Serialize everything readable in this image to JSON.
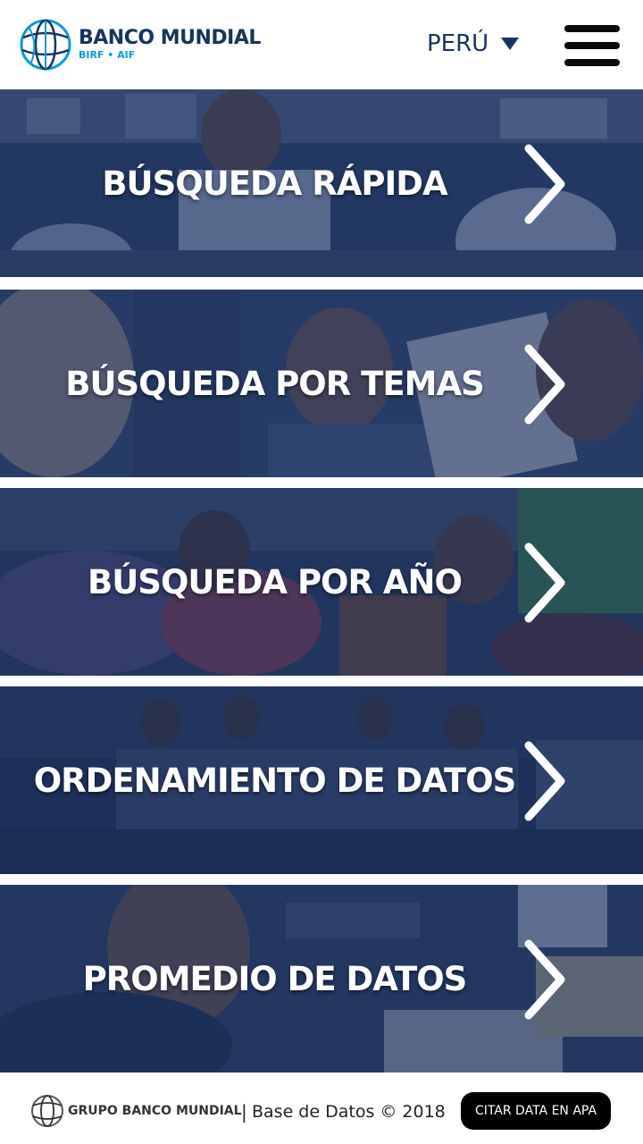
{
  "header": {
    "logo_title": "BANCO MUNDIAL",
    "logo_subtitle": "BIRF • AIF",
    "country": "PERÚ",
    "menu_icon": "hamburger-menu-icon"
  },
  "tiles": [
    {
      "label": "BÚSQUEDA RÁPIDA",
      "icon": "chevron-right-icon"
    },
    {
      "label": "BÚSQUEDA POR TEMAS",
      "icon": "chevron-right-icon"
    },
    {
      "label": "BÚSQUEDA POR AÑO",
      "icon": "chevron-right-icon"
    },
    {
      "label": "ORDENAMIENTO DE DATOS",
      "icon": "chevron-right-icon"
    },
    {
      "label": "PROMEDIO DE DATOS",
      "icon": "chevron-right-icon"
    }
  ],
  "footer": {
    "brand": "GRUPO BANCO MUNDIAL",
    "separator": "|",
    "copyright": "Base de Datos © 2018",
    "cite_button": "CITAR DATA EN APA"
  },
  "colors": {
    "brand_navy": "#16345f",
    "brand_blue": "#0a9bd6",
    "overlay": "#142a58"
  }
}
